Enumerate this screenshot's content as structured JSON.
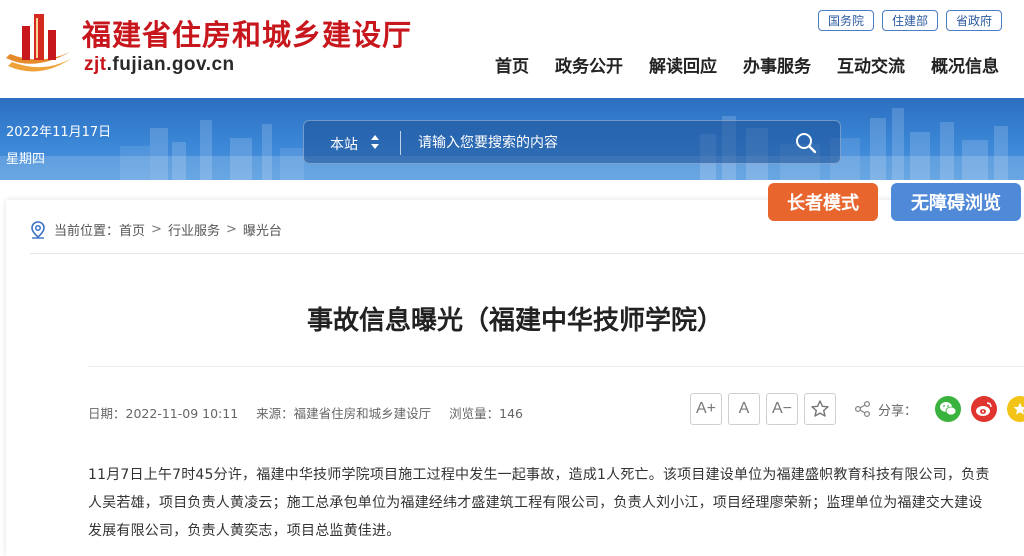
{
  "header": {
    "site_title": "福建省住房和城乡建设厅",
    "domain_prefix": "zjt",
    "domain_rest": ".fujian.gov.cn",
    "top_links": [
      "国务院",
      "住建部",
      "省政府"
    ],
    "nav": [
      "首页",
      "政务公开",
      "解读回应",
      "办事服务",
      "互动交流",
      "概况信息"
    ]
  },
  "banner": {
    "date": "2022年11月17日",
    "weekday": "星期四",
    "search": {
      "scope": "本站",
      "placeholder": "请输入您要搜索的内容"
    }
  },
  "modes": {
    "elder": "长者模式",
    "accessible": "无障碍浏览"
  },
  "breadcrumb": {
    "prefix": "当前位置：",
    "items": [
      "首页",
      "行业服务",
      "曝光台"
    ],
    "separator": ">"
  },
  "article": {
    "title": "事故信息曝光（福建中华技师学院）",
    "meta": {
      "date": "日期：2022-11-09 10:11",
      "source": "来源：福建省住房和城乡建设厅",
      "views": "浏览量：146"
    },
    "tools": {
      "font_up": "A+",
      "font_reset": "A",
      "font_down": "A−"
    },
    "share_label": "分享：",
    "body_lines": [
      "11月7日上午7时45分许，福建中华技师学院项目施工过程中发生一起事故，造成1人死亡。该项目建设单位为福建盛帜教育科技有限公司，负责",
      "人吴若雄，项目负责人黄凌云；施工总承包单位为福建经纬才盛建筑工程有限公司，负责人刘小江，项目经理廖荣新；监理单位为福建交大建设",
      "发展有限公司，负责人黄奕志，项目总监黄佳进。"
    ]
  },
  "colors": {
    "brand_red": "#c8161d",
    "banner_blue": "#3b86d6",
    "elder_orange": "#e8652e",
    "access_blue": "#4f89d8"
  }
}
